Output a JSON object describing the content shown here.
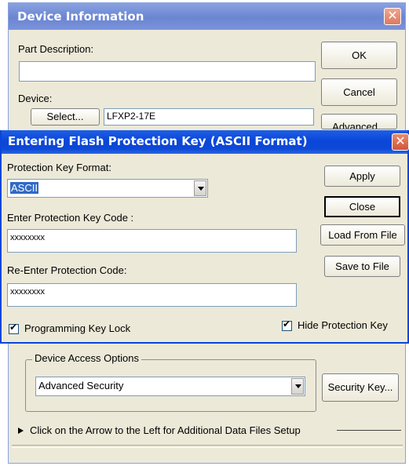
{
  "device_info": {
    "title": "Device Information",
    "part_description_label": "Part Description:",
    "part_description_value": "",
    "device_label": "Device:",
    "select_button": "Select...",
    "device_value": "LFXP2-17E",
    "ok_button": "OK",
    "cancel_button": "Cancel",
    "advanced_button": "Advanced...",
    "device_access_options_label": "Device Access Options",
    "device_access_options_value": "Advanced Security",
    "security_key_button": "Security Key...",
    "data_files_hint": "Click on the Arrow to the Left for Additional Data Files Setup"
  },
  "flash_key_dialog": {
    "title": "Entering Flash Protection Key (ASCII Format)",
    "protection_key_format_label": "Protection Key Format:",
    "protection_key_format_value": "ASCII",
    "enter_code_label": "Enter Protection Key Code :",
    "enter_code_value": "xxxxxxxx",
    "reenter_code_label": "Re-Enter Protection Code:",
    "reenter_code_value": "xxxxxxxx",
    "apply_button": "Apply",
    "close_button": "Close",
    "load_from_file_button": "Load From File",
    "save_to_file_button": "Save to File",
    "programming_key_lock_label": "Programming Key Lock",
    "programming_key_lock_checked": true,
    "hide_protection_key_label": "Hide Protection Key",
    "hide_protection_key_checked": true
  },
  "colors": {
    "title_active": "#0a46d8",
    "title_inactive": "#7a93da",
    "dialog_face": "#ece9d8",
    "selection": "#316ac5"
  }
}
